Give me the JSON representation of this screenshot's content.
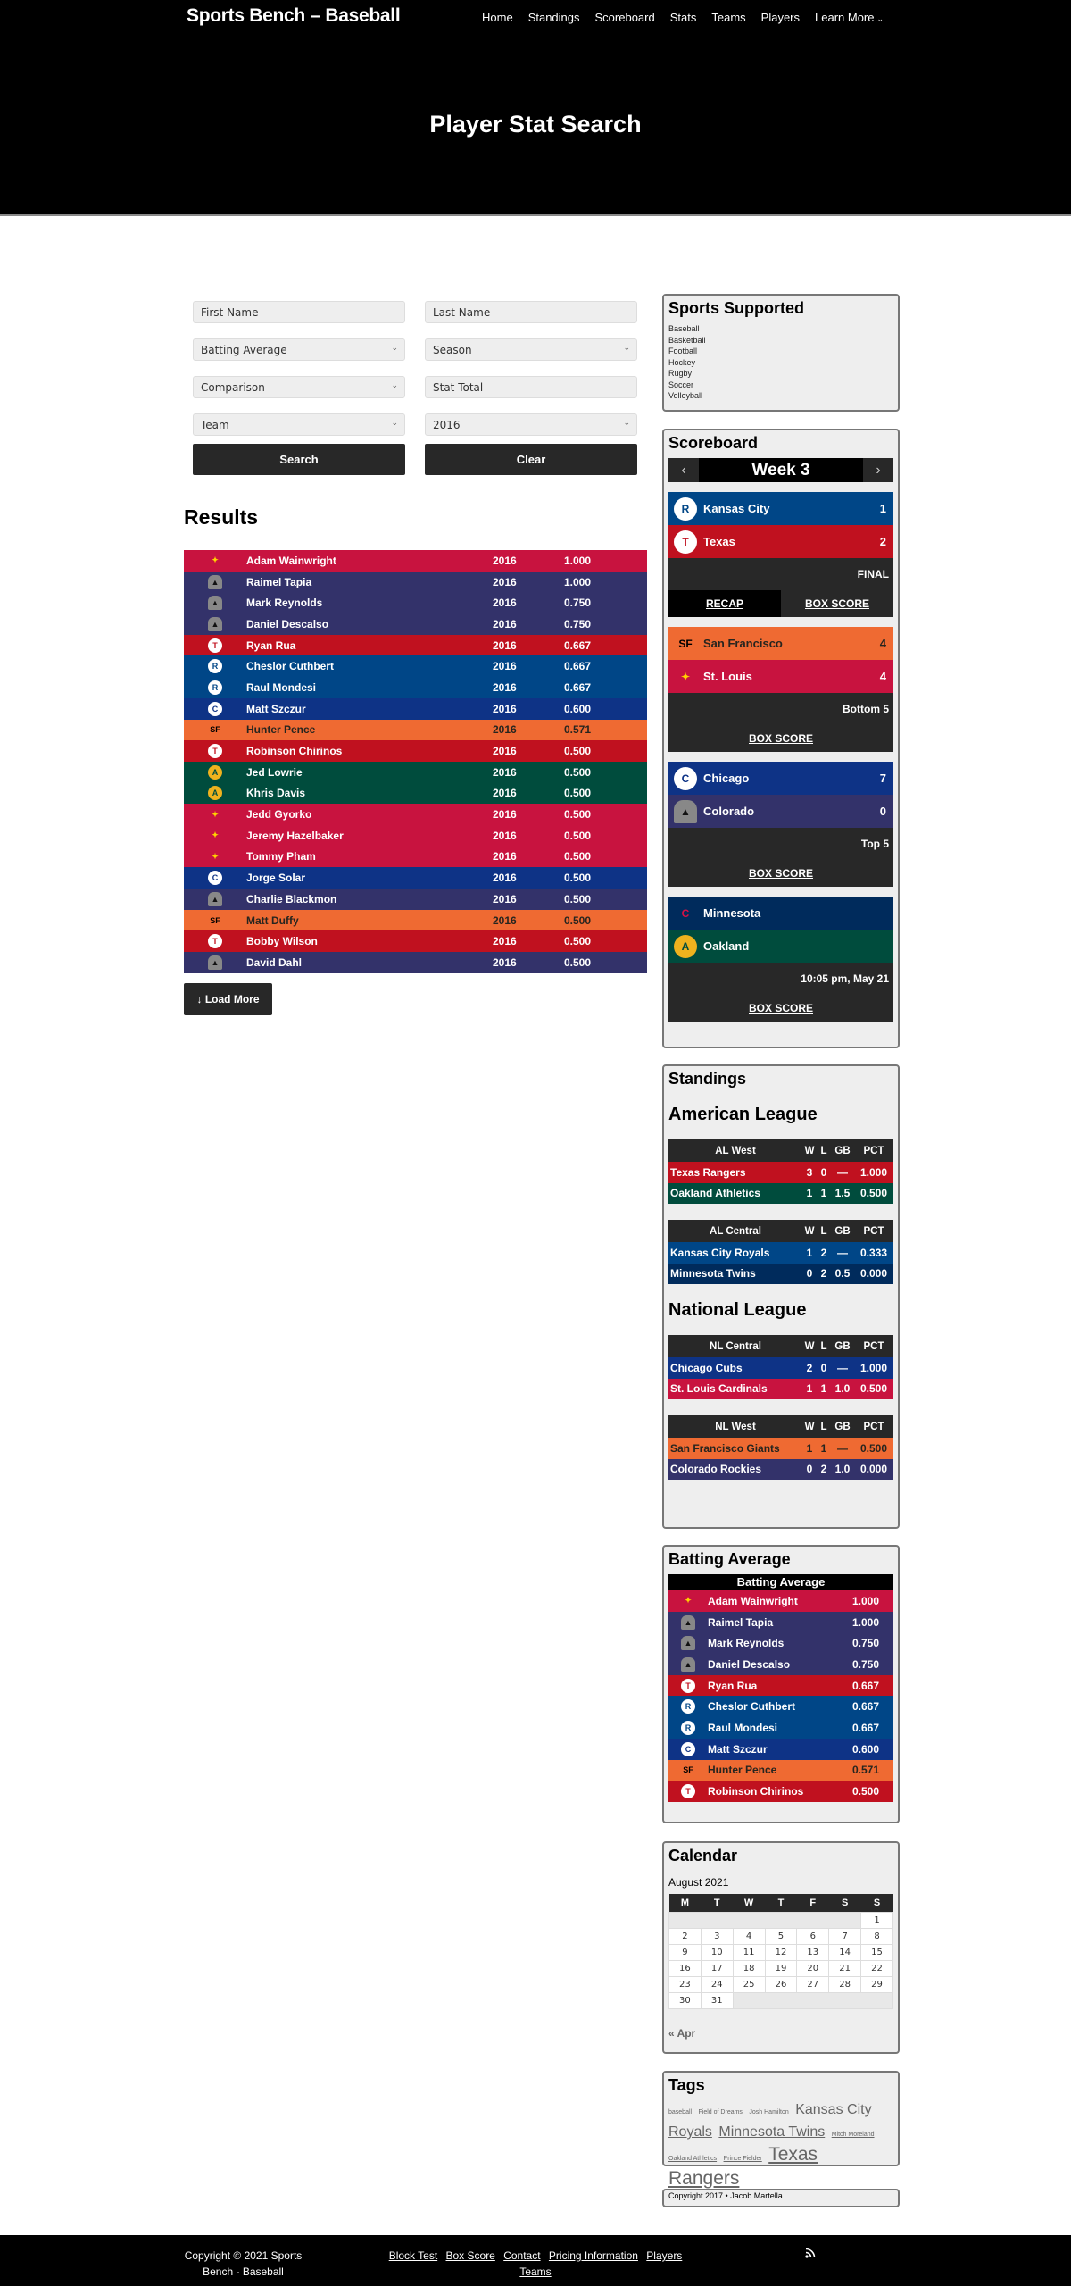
{
  "site": {
    "title": "Sports Bench – Baseball"
  },
  "nav": {
    "items": [
      "Home",
      "Standings",
      "Scoreboard",
      "Stats",
      "Teams",
      "Players"
    ],
    "more": "Learn More"
  },
  "hero": {
    "title": "Player Stat Search"
  },
  "form": {
    "first_name_placeholder": "First Name",
    "last_name_placeholder": "Last Name",
    "stat_select": "Batting Average",
    "season_select": "Season",
    "comparison_select": "Comparison",
    "stat_total_placeholder": "Stat Total",
    "team_select": "Team",
    "year_select": "2016",
    "search_label": "Search",
    "clear_label": "Clear"
  },
  "results": {
    "title": "Results",
    "load_more": "Load More",
    "rows": [
      {
        "team": "cardinals",
        "name": "Adam Wainwright",
        "season": "2016",
        "stat": "1.000"
      },
      {
        "team": "rockies",
        "name": "Raimel Tapia",
        "season": "2016",
        "stat": "1.000"
      },
      {
        "team": "rockies",
        "name": "Mark Reynolds",
        "season": "2016",
        "stat": "0.750"
      },
      {
        "team": "rockies",
        "name": "Daniel Descalso",
        "season": "2016",
        "stat": "0.750"
      },
      {
        "team": "rangers",
        "name": "Ryan Rua",
        "season": "2016",
        "stat": "0.667"
      },
      {
        "team": "royals",
        "name": "Cheslor Cuthbert",
        "season": "2016",
        "stat": "0.667"
      },
      {
        "team": "royals",
        "name": "Raul Mondesi",
        "season": "2016",
        "stat": "0.667"
      },
      {
        "team": "cubs",
        "name": "Matt Szczur",
        "season": "2016",
        "stat": "0.600"
      },
      {
        "team": "giants",
        "name": "Hunter Pence",
        "season": "2016",
        "stat": "0.571"
      },
      {
        "team": "rangers",
        "name": "Robinson Chirinos",
        "season": "2016",
        "stat": "0.500"
      },
      {
        "team": "athletics",
        "name": "Jed Lowrie",
        "season": "2016",
        "stat": "0.500"
      },
      {
        "team": "athletics",
        "name": "Khris Davis",
        "season": "2016",
        "stat": "0.500"
      },
      {
        "team": "cardinals",
        "name": "Jedd Gyorko",
        "season": "2016",
        "stat": "0.500"
      },
      {
        "team": "cardinals",
        "name": "Jeremy Hazelbaker",
        "season": "2016",
        "stat": "0.500"
      },
      {
        "team": "cardinals",
        "name": "Tommy Pham",
        "season": "2016",
        "stat": "0.500"
      },
      {
        "team": "cubs",
        "name": "Jorge Solar",
        "season": "2016",
        "stat": "0.500"
      },
      {
        "team": "rockies",
        "name": "Charlie Blackmon",
        "season": "2016",
        "stat": "0.500"
      },
      {
        "team": "giants",
        "name": "Matt Duffy",
        "season": "2016",
        "stat": "0.500"
      },
      {
        "team": "rangers",
        "name": "Bobby Wilson",
        "season": "2016",
        "stat": "0.500"
      },
      {
        "team": "rockies",
        "name": "David Dahl",
        "season": "2016",
        "stat": "0.500"
      }
    ]
  },
  "team_colors": {
    "cardinals": {
      "bg": "#c8133f",
      "fg": "#ffffff",
      "glyph": "✦"
    },
    "rockies": {
      "bg": "#33326a",
      "fg": "#ffffff",
      "glyph": "▲"
    },
    "rangers": {
      "bg": "#c0111f",
      "fg": "#ffffff",
      "glyph": "T"
    },
    "royals": {
      "bg": "#004687",
      "fg": "#ffffff",
      "glyph": "R"
    },
    "cubs": {
      "bg": "#0e3386",
      "fg": "#ffffff",
      "glyph": "C"
    },
    "giants": {
      "bg": "#ef6a32",
      "fg": "#27251f",
      "glyph": "SF"
    },
    "athletics": {
      "bg": "#004c3d",
      "fg": "#ffffff",
      "glyph": "A"
    },
    "twins": {
      "bg": "#002b5c",
      "fg": "#ffffff",
      "glyph": "C"
    }
  },
  "sports": {
    "title": "Sports Supported",
    "items": [
      "Baseball",
      "Basketball",
      "Football",
      "Hockey",
      "Rugby",
      "Soccer",
      "Volleyball"
    ]
  },
  "scoreboard": {
    "title": "Scoreboard",
    "week": "Week 3",
    "games": [
      {
        "away": {
          "team": "royals",
          "name": "Kansas City",
          "score": "1"
        },
        "home": {
          "team": "rangers",
          "name": "Texas",
          "score": "2"
        },
        "status": "FINAL",
        "recap": "RECAP",
        "box": "BOX SCORE"
      },
      {
        "away": {
          "team": "giants",
          "name": "San Francisco",
          "score": "4"
        },
        "home": {
          "team": "cardinals",
          "name": "St. Louis",
          "score": "4"
        },
        "status": "Bottom 5",
        "box": "BOX SCORE"
      },
      {
        "away": {
          "team": "cubs",
          "name": "Chicago",
          "score": "7"
        },
        "home": {
          "team": "rockies",
          "name": "Colorado",
          "score": "0"
        },
        "status": "Top 5",
        "box": "BOX SCORE"
      },
      {
        "away": {
          "team": "twins",
          "name": "Minnesota",
          "score": ""
        },
        "home": {
          "team": "athletics",
          "name": "Oakland",
          "score": ""
        },
        "status": "10:05 pm, May 21",
        "box": "BOX SCORE"
      }
    ]
  },
  "standings": {
    "title": "Standings",
    "leagues": [
      {
        "name": "American League",
        "divisions": [
          {
            "name": "AL West",
            "rows": [
              {
                "team": "rangers",
                "name": "Texas Rangers",
                "w": "3",
                "l": "0",
                "gb": "—",
                "pct": "1.000"
              },
              {
                "team": "athletics",
                "name": "Oakland Athletics",
                "w": "1",
                "l": "1",
                "gb": "1.5",
                "pct": "0.500"
              }
            ]
          },
          {
            "name": "AL Central",
            "rows": [
              {
                "team": "royals",
                "name": "Kansas City Royals",
                "w": "1",
                "l": "2",
                "gb": "—",
                "pct": "0.333"
              },
              {
                "team": "twins",
                "name": "Minnesota Twins",
                "w": "0",
                "l": "2",
                "gb": "0.5",
                "pct": "0.000"
              }
            ]
          }
        ]
      },
      {
        "name": "National League",
        "divisions": [
          {
            "name": "NL Central",
            "rows": [
              {
                "team": "cubs",
                "name": "Chicago Cubs",
                "w": "2",
                "l": "0",
                "gb": "—",
                "pct": "1.000"
              },
              {
                "team": "cardinals",
                "name": "St. Louis Cardinals",
                "w": "1",
                "l": "1",
                "gb": "1.0",
                "pct": "0.500"
              }
            ]
          },
          {
            "name": "NL West",
            "rows": [
              {
                "team": "giants",
                "name": "San Francisco Giants",
                "w": "1",
                "l": "1",
                "gb": "—",
                "pct": "0.500"
              },
              {
                "team": "rockies",
                "name": "Colorado Rockies",
                "w": "0",
                "l": "2",
                "gb": "1.0",
                "pct": "0.000"
              }
            ]
          }
        ]
      }
    ],
    "headers": {
      "w": "W",
      "l": "L",
      "gb": "GB",
      "pct": "PCT"
    }
  },
  "batting_widget": {
    "title": "Batting Average",
    "table_title": "Batting Average",
    "count": 10
  },
  "calendar": {
    "title": "Calendar",
    "caption": "August 2021",
    "days": [
      "M",
      "T",
      "W",
      "T",
      "F",
      "S",
      "S"
    ],
    "weeks": [
      [
        "",
        "",
        "",
        "",
        "",
        "",
        "1"
      ],
      [
        "2",
        "3",
        "4",
        "5",
        "6",
        "7",
        "8"
      ],
      [
        "9",
        "10",
        "11",
        "12",
        "13",
        "14",
        "15"
      ],
      [
        "16",
        "17",
        "18",
        "19",
        "20",
        "21",
        "22"
      ],
      [
        "23",
        "24",
        "25",
        "26",
        "27",
        "28",
        "29"
      ],
      [
        "30",
        "31",
        "",
        "",
        "",
        "",
        ""
      ]
    ],
    "prev": "« Apr"
  },
  "tags": {
    "title": "Tags",
    "items": [
      {
        "label": "baseball",
        "weight": 1
      },
      {
        "label": "Field of Dreams",
        "weight": 1
      },
      {
        "label": "Josh Hamilton",
        "weight": 1
      },
      {
        "label": "Kansas City Royals",
        "weight": 3
      },
      {
        "label": "Minnesota Twins",
        "weight": 3
      },
      {
        "label": "Mitch Moreland",
        "weight": 1
      },
      {
        "label": "Oakland Athletics",
        "weight": 1
      },
      {
        "label": "Prince Fielder",
        "weight": 1
      },
      {
        "label": "Texas Rangers",
        "weight": 4
      }
    ]
  },
  "widget_copyright": "Copyright 2017 • Jacob Martella",
  "footer": {
    "copyright": "Copyright © 2021 Sports Bench - Baseball",
    "links": [
      "Block Test",
      "Box Score",
      "Contact",
      "Pricing Information",
      "Players",
      "Teams"
    ],
    "rss_icon": "rss-icon"
  }
}
